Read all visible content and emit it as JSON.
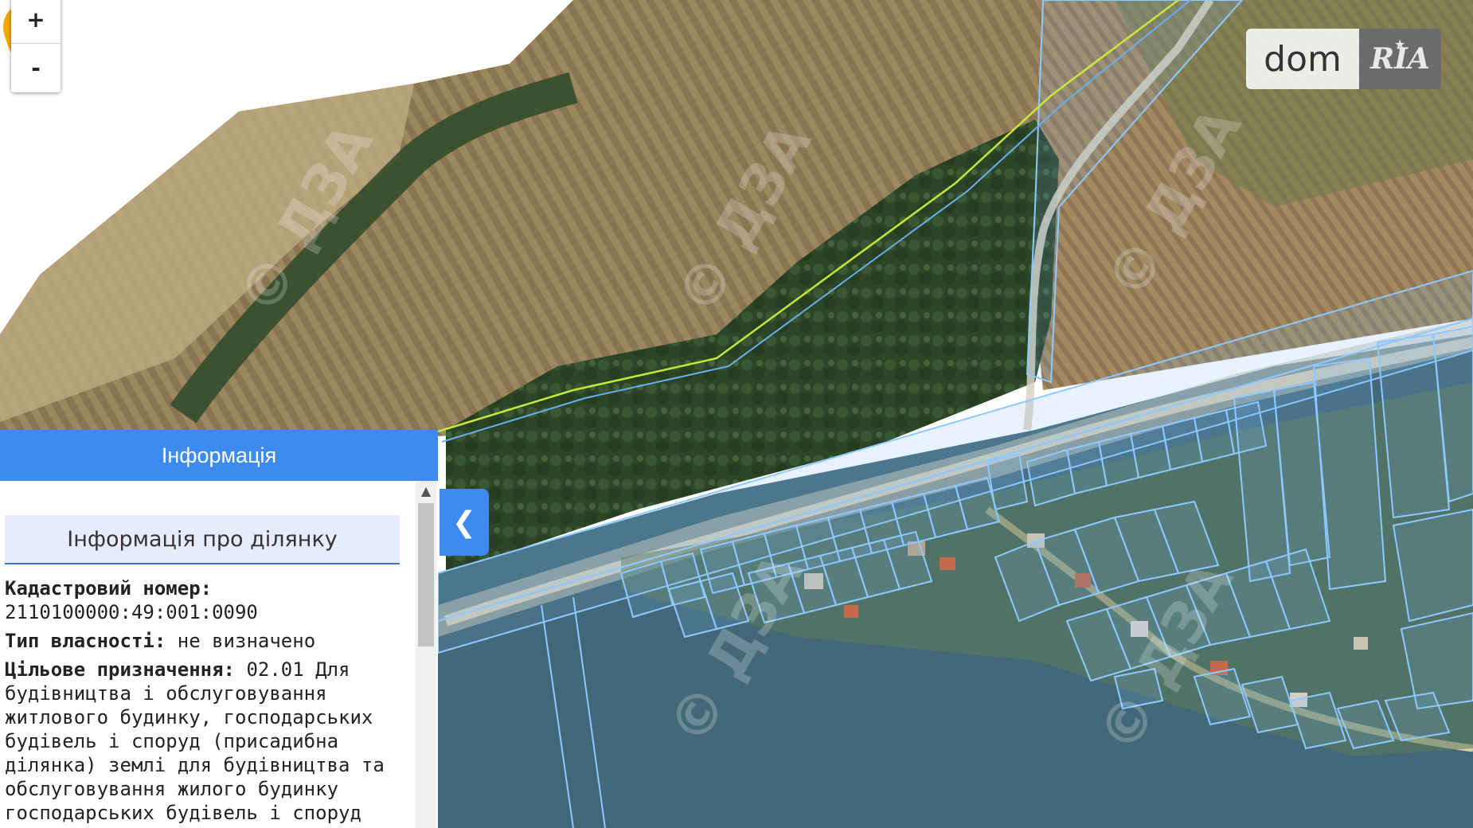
{
  "map": {
    "zoom_in_label": "+",
    "zoom_out_label": "-",
    "watermark_text": "© ДЗА",
    "colors": {
      "field_light": "#b7a27a",
      "field_dark": "#7b6a48",
      "forest": "#2f4a2a",
      "forest_water_tint": "#39627a",
      "parcel_outline": "#8ec9ff",
      "boundary_line": "#c8e63c",
      "marker": "#f2a900"
    }
  },
  "logo": {
    "dom_text": "dom",
    "ria_text": "RIA"
  },
  "panel": {
    "header_title": "Інформація",
    "section_title": "Інформація про ділянку",
    "cadastral_label": "Кадастровий номер:",
    "cadastral_value": "2110100000:49:001:0090",
    "ownership_label": "Тип власності:",
    "ownership_value": "не визначено",
    "purpose_label": "Цільове призначення:",
    "purpose_value": "02.01 Для будівництва і обслуговування житлового будинку, господарських будівель і споруд (присадибна ділянка) землі для будівництва та обслуговування жилого будинку господарських будівель і споруд",
    "collapse_icon": "chevron-left-icon",
    "colors": {
      "header_bg": "#3d8af0",
      "section_bg": "#e5ecfb"
    }
  }
}
